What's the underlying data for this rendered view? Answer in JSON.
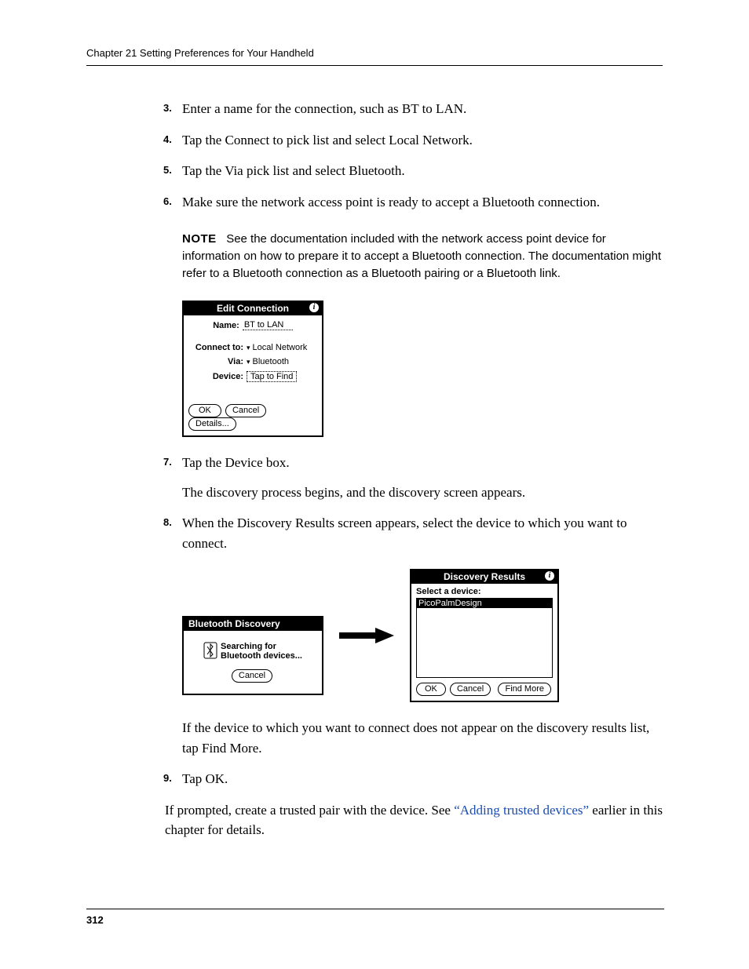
{
  "header": "Chapter 21    Setting Preferences for Your Handheld",
  "page_number": "312",
  "steps": {
    "s3": {
      "num": "3.",
      "text": "Enter a name for the connection, such as BT to LAN."
    },
    "s4": {
      "num": "4.",
      "text": "Tap the Connect to pick list and select Local Network."
    },
    "s5": {
      "num": "5.",
      "text": "Tap the Via pick list and select Bluetooth."
    },
    "s6": {
      "num": "6.",
      "text": "Make sure the network access point is ready to accept a Bluetooth connection."
    },
    "s7": {
      "num": "7.",
      "text": "Tap the Device box.",
      "sub": "The discovery process begins, and the discovery screen appears."
    },
    "s8": {
      "num": "8.",
      "text": "When the Discovery Results screen appears, select the device to which you want to connect.",
      "sub": "If the device to which you want to connect does not appear on the discovery results list, tap Find More."
    },
    "s9": {
      "num": "9.",
      "text": "Tap OK."
    }
  },
  "note": {
    "label": "NOTE",
    "text": "See the documentation included with the network access point device for information on how to prepare it to accept a Bluetooth connection. The documentation might refer to a Bluetooth connection as a Bluetooth pairing or a Bluetooth link."
  },
  "closing": {
    "pre": "If prompted, create a trusted pair with the device. See ",
    "link": "“Adding trusted devices”",
    "post": " earlier in this chapter for details."
  },
  "dialog_edit": {
    "title": "Edit Connection",
    "name_label": "Name:",
    "name_value": "BT to LAN",
    "connect_label": "Connect to:",
    "connect_value": "Local Network",
    "via_label": "Via:",
    "via_value": "Bluetooth",
    "device_label": "Device:",
    "device_value": "Tap to Find",
    "ok": "OK",
    "cancel": "Cancel",
    "details": "Details..."
  },
  "dialog_discovery": {
    "title": "Bluetooth Discovery",
    "line1": "Searching for",
    "line2": "Bluetooth devices...",
    "cancel": "Cancel"
  },
  "dialog_results": {
    "title": "Discovery Results",
    "prompt": "Select a device:",
    "item": "PicoPalmDesign",
    "ok": "OK",
    "cancel": "Cancel",
    "findmore": "Find More"
  }
}
